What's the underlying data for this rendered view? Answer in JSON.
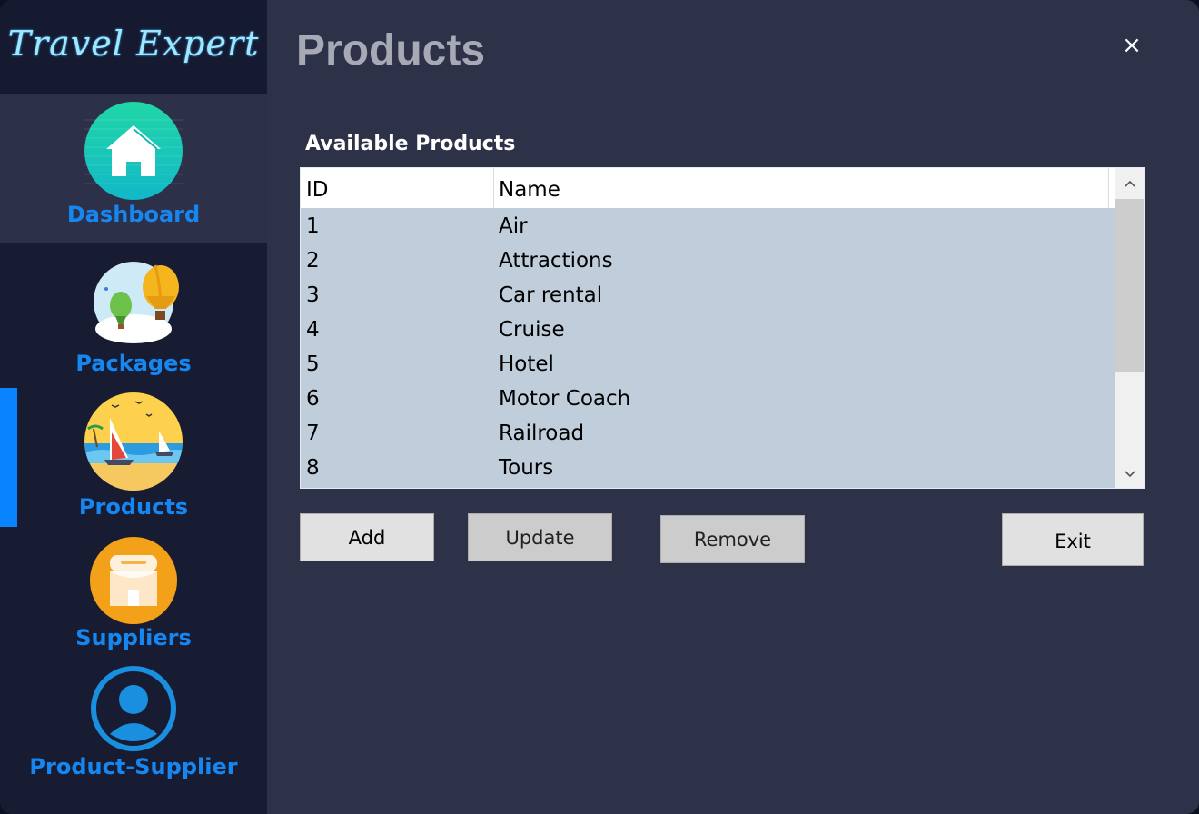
{
  "app": {
    "logo": "Travel Expert",
    "close": "×"
  },
  "sidebar": {
    "items": [
      {
        "label": "Dashboard",
        "icon": "home-icon"
      },
      {
        "label": "Packages",
        "icon": "balloon-icon"
      },
      {
        "label": "Products",
        "icon": "sailboat-icon"
      },
      {
        "label": "Suppliers",
        "icon": "store-icon"
      },
      {
        "label": "Product-Supplier",
        "icon": "user-icon"
      }
    ],
    "accent_color": "#0a83ff",
    "label_color": "#1686f0"
  },
  "page": {
    "title": "Products",
    "section_label": "Available Products"
  },
  "table": {
    "columns": [
      "ID",
      "Name"
    ],
    "rows": [
      {
        "id": "1",
        "name": "Air"
      },
      {
        "id": "2",
        "name": "Attractions"
      },
      {
        "id": "3",
        "name": "Car rental"
      },
      {
        "id": "4",
        "name": "Cruise"
      },
      {
        "id": "5",
        "name": "Hotel"
      },
      {
        "id": "6",
        "name": "Motor Coach"
      },
      {
        "id": "7",
        "name": "Railroad"
      },
      {
        "id": "8",
        "name": "Tours"
      }
    ]
  },
  "buttons": {
    "add": "Add",
    "update": "Update",
    "remove": "Remove",
    "exit": "Exit"
  }
}
